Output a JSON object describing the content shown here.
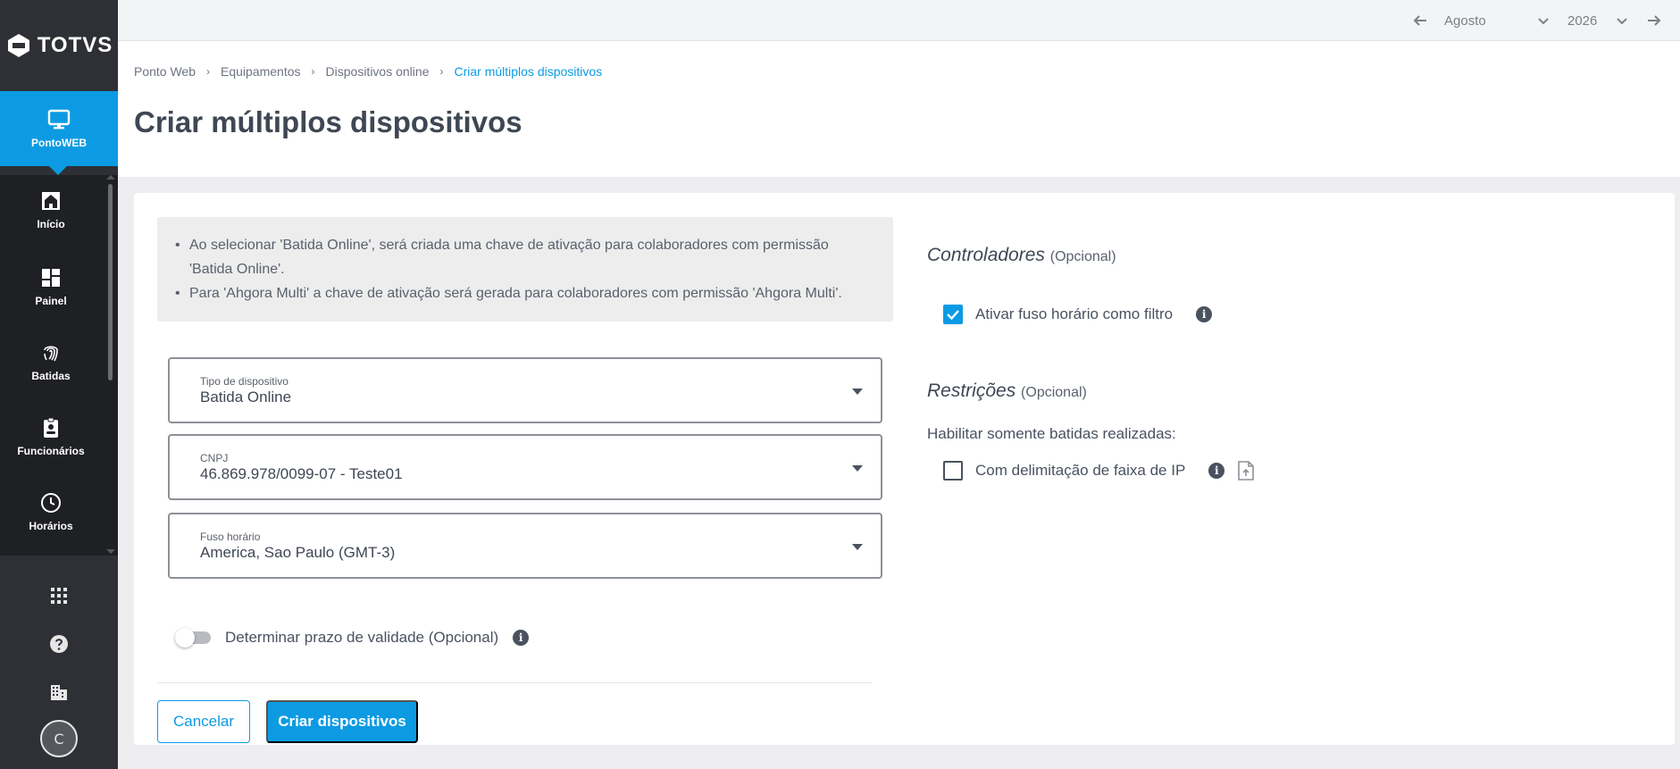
{
  "sidebar": {
    "logo_text": "TOTVS",
    "active_item": {
      "label": "PontoWEB",
      "icon": "monitor-icon"
    },
    "items": [
      {
        "label": "Início",
        "icon": "home-icon"
      },
      {
        "label": "Painel",
        "icon": "dashboard-icon"
      },
      {
        "label": "Batidas",
        "icon": "fingerprint-icon"
      },
      {
        "label": "Funcionários",
        "icon": "badge-icon"
      },
      {
        "label": "Horários",
        "icon": "clock-icon"
      }
    ],
    "tools": [
      "apps-grid-icon",
      "help-icon",
      "company-building-icon"
    ],
    "avatar_initial": "C"
  },
  "topbar": {
    "month": "Agosto",
    "year": "2026"
  },
  "breadcrumb": [
    "Ponto Web",
    "Equipamentos",
    "Dispositivos online",
    "Criar múltiplos dispositivos"
  ],
  "page_title": "Criar múltiplos dispositivos",
  "info": {
    "line1": "Ao selecionar 'Batida Online', será criada uma chave de ativação para colaboradores com permissão 'Batida Online'.",
    "line2": "Para 'Ahgora Multi' a chave de ativação será gerada para colaboradores com permissão 'Ahgora Multi'."
  },
  "fields": {
    "device_type": {
      "label": "Tipo de dispositivo",
      "value": "Batida Online"
    },
    "cnpj": {
      "label": "CNPJ",
      "value": "46.869.978/0099-07 - Teste01"
    },
    "timezone": {
      "label": "Fuso horário",
      "value": "America, Sao Paulo (GMT-3)"
    }
  },
  "validity_toggle": {
    "label": "Determinar prazo de validade (Opcional)",
    "checked": false
  },
  "buttons": {
    "cancel": "Cancelar",
    "create": "Criar dispositivos"
  },
  "controllers": {
    "title": "Controladores",
    "optional": "(Opcional)",
    "timezone_filter": {
      "label": "Ativar fuso horário como filtro",
      "checked": true
    }
  },
  "restrictions": {
    "title": "Restrições",
    "optional": "(Opcional)",
    "sublabel": "Habilitar somente batidas realizadas:",
    "ip_range": {
      "label": "Com delimitação de faixa de IP",
      "checked": false
    }
  },
  "colors": {
    "accent": "#0c9be3",
    "sidebar": "#2e3035"
  }
}
